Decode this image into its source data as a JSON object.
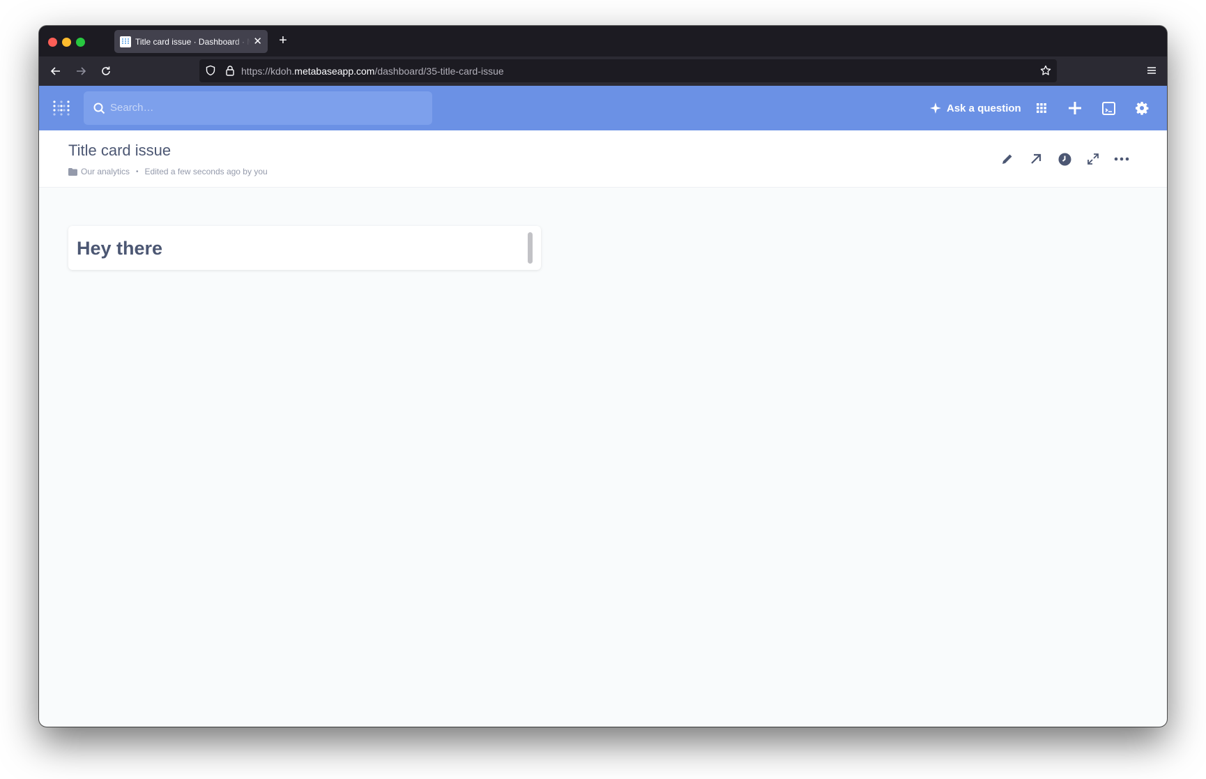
{
  "browser": {
    "tab_title": "Title card issue · Dashboard · Metabase",
    "url_prefix": "https://kdoh.",
    "url_domain": "metabaseapp.com",
    "url_path": "/dashboard/35-title-card-issue"
  },
  "metabase": {
    "search_placeholder": "Search…",
    "ask_label": "Ask a question",
    "brand_color": "#6b91e5"
  },
  "dashboard": {
    "title": "Title card issue",
    "collection": "Our analytics",
    "edited": "Edited a few seconds ago by you"
  },
  "card": {
    "heading": "Hey there"
  }
}
